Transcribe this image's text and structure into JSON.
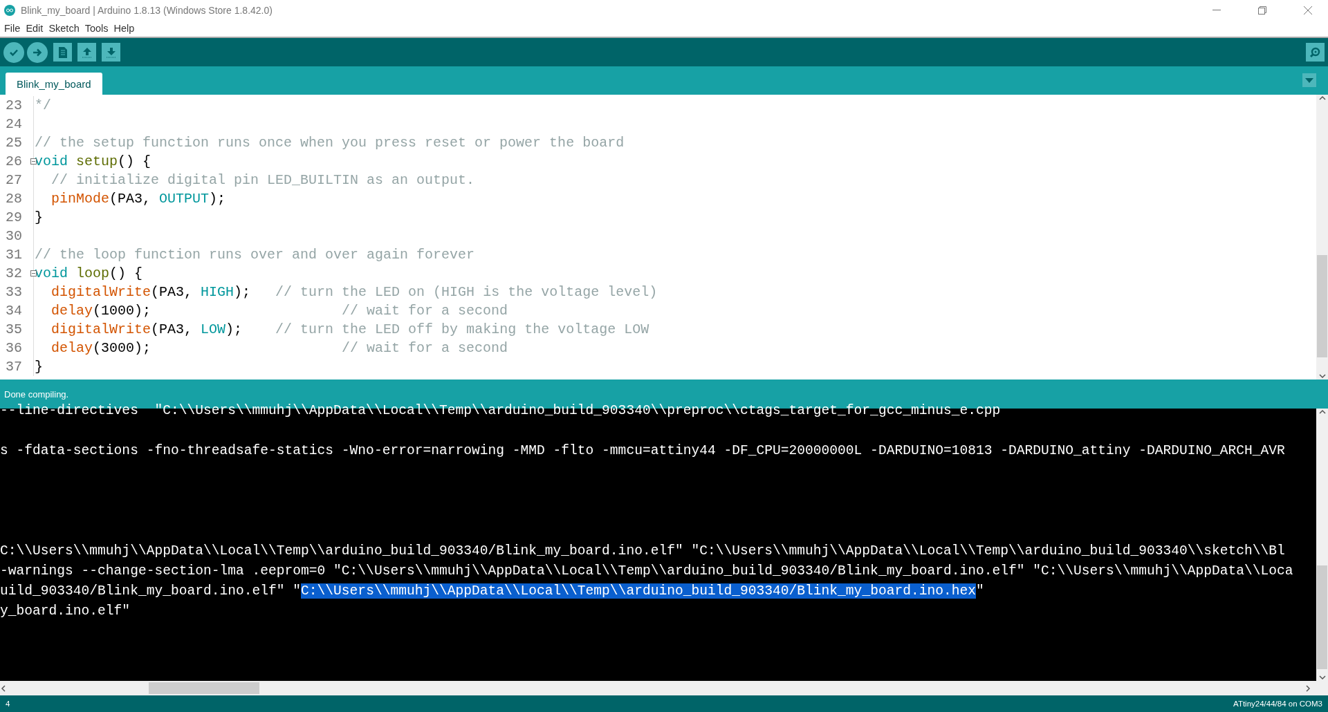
{
  "window": {
    "title": "Blink_my_board | Arduino 1.8.13 (Windows Store 1.8.42.0)"
  },
  "menu": [
    "File",
    "Edit",
    "Sketch",
    "Tools",
    "Help"
  ],
  "tabs": [
    {
      "label": "Blink_my_board",
      "selected": true
    }
  ],
  "code": [
    {
      "number": "23",
      "foldable": false,
      "tokens": [
        {
          "kind": "comment",
          "text": "*/"
        }
      ]
    },
    {
      "number": "24",
      "foldable": false
    },
    {
      "number": "25",
      "foldable": false,
      "tokens": [
        {
          "kind": "comment",
          "text": "// the setup function runs once when you press reset or power the board"
        }
      ]
    },
    {
      "number": "26",
      "foldable": true,
      "tokens": [
        {
          "kind": "keyword",
          "text": "void "
        },
        {
          "kind": "name",
          "text": "setup"
        },
        {
          "kind": "plain",
          "text": "() {"
        }
      ]
    },
    {
      "number": "27",
      "foldable": false,
      "tokens": [
        {
          "kind": "comment",
          "text": "  // initialize digital pin LED_BUILTIN as an output."
        }
      ]
    },
    {
      "number": "28",
      "foldable": false,
      "tokens": [
        {
          "kind": "function",
          "text": "  pinMode"
        },
        {
          "kind": "plain",
          "text": "(PA3, "
        },
        {
          "kind": "keyword",
          "text": "OUTPUT"
        },
        {
          "kind": "plain",
          "text": ");"
        }
      ]
    },
    {
      "number": "29",
      "foldable": false,
      "tokens": [
        {
          "kind": "plain",
          "text": "}"
        }
      ]
    },
    {
      "number": "30",
      "foldable": false
    },
    {
      "number": "31",
      "foldable": false,
      "tokens": [
        {
          "kind": "comment",
          "text": "// the loop function runs over and over again forever"
        }
      ]
    },
    {
      "number": "32",
      "foldable": true,
      "tokens": [
        {
          "kind": "keyword",
          "text": "void "
        },
        {
          "kind": "name",
          "text": "loop"
        },
        {
          "kind": "plain",
          "text": "() {"
        }
      ]
    },
    {
      "number": "33",
      "foldable": false,
      "tokens": [
        {
          "kind": "function",
          "text": "  digitalWrite"
        },
        {
          "kind": "plain",
          "text": "(PA3, "
        },
        {
          "kind": "keyword",
          "text": "HIGH"
        },
        {
          "kind": "plain",
          "text": ");   "
        },
        {
          "kind": "comment",
          "text": "// turn the LED on (HIGH is the voltage level)"
        }
      ]
    },
    {
      "number": "34",
      "foldable": false,
      "tokens": [
        {
          "kind": "function",
          "text": "  delay"
        },
        {
          "kind": "plain",
          "text": "(1000);                       "
        },
        {
          "kind": "comment",
          "text": "// wait for a second"
        }
      ]
    },
    {
      "number": "35",
      "foldable": false,
      "tokens": [
        {
          "kind": "function",
          "text": "  digitalWrite"
        },
        {
          "kind": "plain",
          "text": "(PA3, "
        },
        {
          "kind": "keyword",
          "text": "LOW"
        },
        {
          "kind": "plain",
          "text": ");    "
        },
        {
          "kind": "comment",
          "text": "// turn the LED off by making the voltage LOW"
        }
      ]
    },
    {
      "number": "36",
      "foldable": false,
      "tokens": [
        {
          "kind": "function",
          "text": "  delay"
        },
        {
          "kind": "plain",
          "text": "(3000);                       "
        },
        {
          "kind": "comment",
          "text": "// wait for a second"
        }
      ]
    },
    {
      "number": "37",
      "foldable": false,
      "tokens": [
        {
          "kind": "plain",
          "text": "}"
        }
      ]
    }
  ],
  "message": "Done compiling.",
  "console": [
    {
      "kind": "text",
      "segments": [
        {
          "text": "--line-directives  \"C:\\\\Users\\\\mmuhj\\\\AppData\\\\Local\\\\Temp\\\\arduino_build_903340\\\\preproc\\\\ctags_target_for_gcc_minus_e.cpp",
          "selected": false
        }
      ]
    },
    {
      "kind": "blank"
    },
    {
      "kind": "text",
      "segments": [
        {
          "text": "s -fdata-sections -fno-threadsafe-statics -Wno-error=narrowing -MMD -flto -mmcu=attiny44 -DF_CPU=20000000L -DARDUINO=10813 -DARDUINO_attiny -DARDUINO_ARCH_AVR",
          "selected": false
        }
      ]
    },
    {
      "kind": "blank"
    },
    {
      "kind": "blank"
    },
    {
      "kind": "blank"
    },
    {
      "kind": "blank"
    },
    {
      "kind": "text",
      "segments": [
        {
          "text": "C:\\\\Users\\\\mmuhj\\\\AppData\\\\Local\\\\Temp\\\\arduino_build_903340/Blink_my_board.ino.elf\" \"C:\\\\Users\\\\mmuhj\\\\AppData\\\\Local\\\\Temp\\\\arduino_build_903340\\\\sketch\\\\Bl",
          "selected": false
        }
      ]
    },
    {
      "kind": "text",
      "segments": [
        {
          "text": "-warnings --change-section-lma .eeprom=0 \"C:\\\\Users\\\\mmuhj\\\\AppData\\\\Local\\\\Temp\\\\arduino_build_903340/Blink_my_board.ino.elf\" \"C:\\\\Users\\\\mmuhj\\\\AppData\\\\Loca",
          "selected": false
        }
      ]
    },
    {
      "kind": "text",
      "segments": [
        {
          "text": "uild_903340/Blink_my_board.ino.elf\" \"",
          "selected": false
        },
        {
          "text": "C:\\\\Users\\\\mmuhj\\\\AppData\\\\Local\\\\Temp\\\\arduino_build_903340/Blink_my_board.ino.hex",
          "selected": true
        },
        {
          "text": "\"",
          "selected": false
        }
      ]
    },
    {
      "kind": "text",
      "segments": [
        {
          "text": "y_board.ino.elf\"",
          "selected": false
        }
      ]
    }
  ],
  "status_bar": {
    "line": "4",
    "board": "ATtiny24/44/84 on COM3"
  }
}
